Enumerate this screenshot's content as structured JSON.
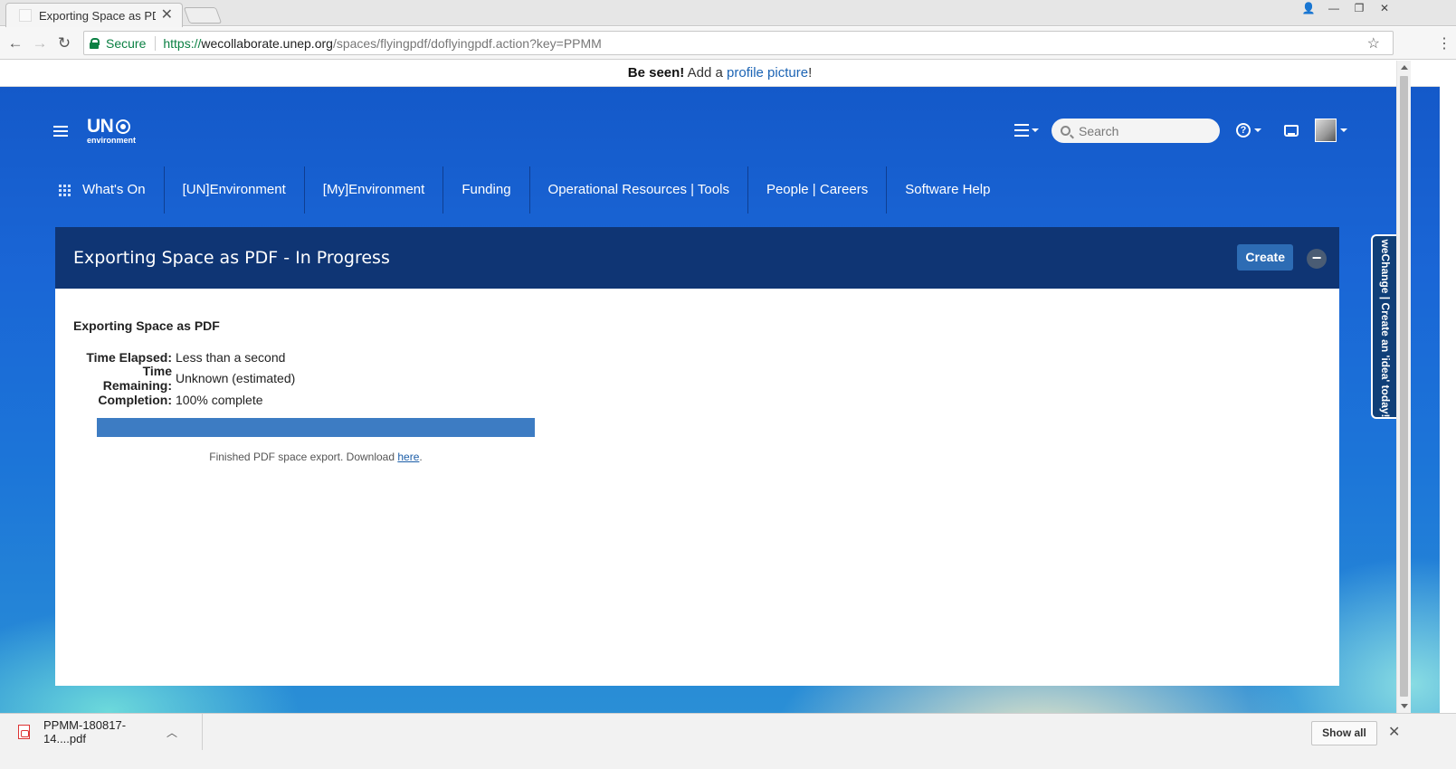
{
  "browser": {
    "tab_title": "Exporting Space as PDF",
    "tab_close": "✕",
    "window_controls": [
      "👤",
      "—",
      "❐",
      "✕"
    ],
    "nav": {
      "back": "←",
      "forward": "→",
      "reload": "↻"
    },
    "secure_label": "Secure",
    "url_scheme": "https://",
    "url_host": "wecollaborate.unep.org",
    "url_path": "/spaces/flyingpdf/doflyingpdf.action?key=PPMM",
    "star": "☆",
    "menu": "⋮"
  },
  "announcement": {
    "bold": "Be seen!",
    "text": " Add a ",
    "link": "profile picture",
    "end": "!"
  },
  "header": {
    "logo_main": "UN",
    "logo_sub": "environment",
    "search_placeholder": "Search",
    "help_glyph": "?"
  },
  "mainnav": {
    "items": [
      "What's On",
      "[UN]Environment",
      "[My]Environment",
      "Funding",
      "Operational Resources | Tools",
      "People | Careers",
      "Software Help"
    ]
  },
  "panel": {
    "title": "Exporting Space as PDF - In Progress",
    "create_label": "Create",
    "collapse_glyph": "−",
    "heading": "Exporting Space as PDF",
    "rows": [
      {
        "label": "Time Elapsed:",
        "value": "Less than a second"
      },
      {
        "label": "Time Remaining:",
        "value": "Unknown (estimated)"
      },
      {
        "label": "Completion:",
        "value": "100% complete"
      }
    ],
    "progress_percent": 100,
    "finished_text": "Finished PDF space export. Download ",
    "finished_link": "here",
    "finished_end": "."
  },
  "feedback_tab": "weChange | Create an 'idea' today!",
  "downloads": {
    "file_name": "PPMM-180817-14....pdf",
    "chevron": "︿",
    "show_all": "Show all",
    "close": "✕"
  },
  "colors": {
    "accent": "#2d6cb4",
    "progress": "#3d7cc3",
    "secure": "#0b8043",
    "link": "#1c64b4"
  }
}
